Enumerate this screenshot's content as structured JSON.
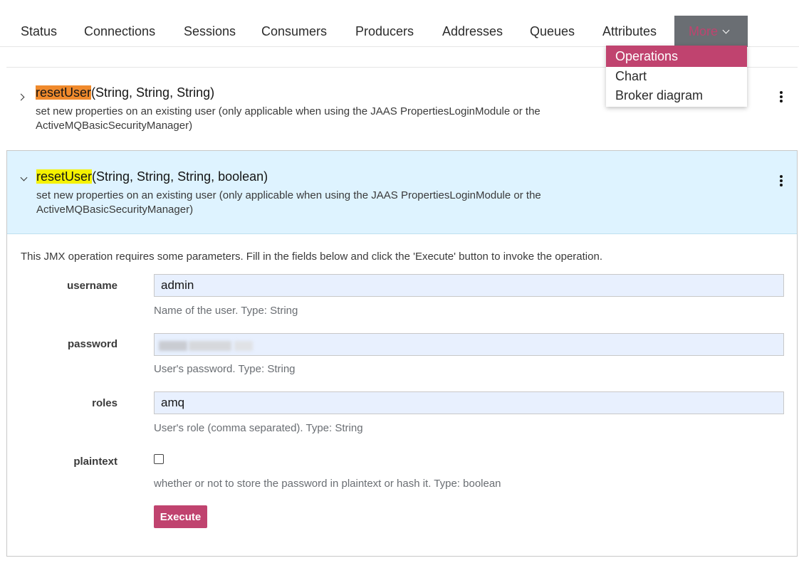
{
  "nav": {
    "tabs": [
      {
        "label": "Status"
      },
      {
        "label": "Connections"
      },
      {
        "label": "Sessions"
      },
      {
        "label": "Consumers"
      },
      {
        "label": "Producers"
      },
      {
        "label": "Addresses"
      },
      {
        "label": "Queues"
      },
      {
        "label": "Attributes"
      }
    ],
    "more_label": "More",
    "more_items": [
      {
        "label": "Operations",
        "active": true
      },
      {
        "label": "Chart"
      },
      {
        "label": "Broker diagram"
      }
    ]
  },
  "operations": [
    {
      "name": "resetUser",
      "signature": "(String, String, String)",
      "description": "set new properties on an existing user (only applicable when using the JAAS PropertiesLoginModule or the ActiveMQBasicSecurityManager)",
      "expanded": false
    },
    {
      "name": "resetUser",
      "signature": "(String, String, String, boolean)",
      "description": "set new properties on an existing user (only applicable when using the JAAS PropertiesLoginModule or the ActiveMQBasicSecurityManager)",
      "expanded": true
    }
  ],
  "form": {
    "intro": "This JMX operation requires some parameters. Fill in the fields below and click the 'Execute' button to invoke the operation.",
    "fields": [
      {
        "label": "username",
        "value": "admin",
        "help": "Name of the user. Type: String"
      },
      {
        "label": "password",
        "value": "",
        "help": "User's password. Type: String"
      },
      {
        "label": "roles",
        "value": "amq",
        "help": "User's role (comma separated). Type: String"
      },
      {
        "label": "plaintext",
        "checked": false,
        "help": "whether or not to store the password in plaintext or hash it. Type: boolean"
      }
    ],
    "execute_label": "Execute"
  },
  "colors": {
    "accent": "#c0436f",
    "expanded_bg": "#def3ff",
    "more_bg": "#6a6e73",
    "highlight_orange": "#f08a2c",
    "highlight_yellow": "#f5f200"
  }
}
